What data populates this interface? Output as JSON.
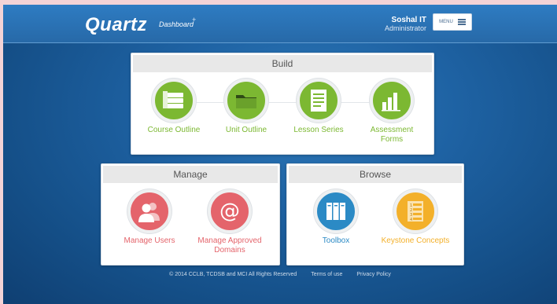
{
  "header": {
    "logo": "Quartz",
    "logo_sub": "Dashboard",
    "user_name": "Soshal IT",
    "user_role": "Administrator",
    "menu_label": "MENU"
  },
  "build": {
    "title": "Build",
    "items": [
      {
        "label": "Course Outline",
        "icon": "stacked-folders-icon",
        "color": "#7cb832"
      },
      {
        "label": "Unit Outline",
        "icon": "folder-icon",
        "color": "#7cb832"
      },
      {
        "label": "Lesson Series",
        "icon": "document-list-icon",
        "color": "#7cb832"
      },
      {
        "label_line1": "Assessment",
        "label_line2": "Forms",
        "icon": "bar-chart-icon",
        "color": "#7cb832"
      }
    ]
  },
  "manage": {
    "title": "Manage",
    "items": [
      {
        "label": "Manage Users",
        "icon": "users-icon",
        "color": "#e4646b"
      },
      {
        "label_line1": "Manage Approved",
        "label_line2": "Domains",
        "icon": "at-sign-icon",
        "color": "#e4646b"
      }
    ]
  },
  "browse": {
    "title": "Browse",
    "items": [
      {
        "label": "Toolbox",
        "icon": "binders-icon",
        "color": "#2b8ac5"
      },
      {
        "label": "Keystone Concepts",
        "icon": "numbered-list-icon",
        "color": "#f3b02a"
      }
    ]
  },
  "footer": {
    "copyright": "© 2014 CCLB, TCDSB and MCI All Rights Reserved",
    "terms": "Terms of use",
    "privacy": "Privacy Policy"
  }
}
